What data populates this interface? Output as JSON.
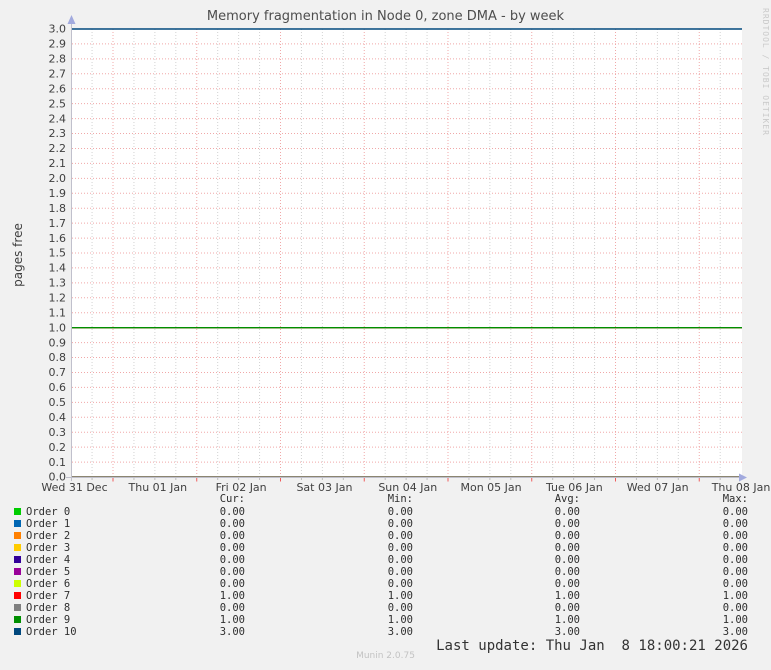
{
  "title": "Memory fragmentation in Node 0, zone DMA - by week",
  "watermark": "RRDTOOL / TOBI OETIKER",
  "footer": {
    "last_update": "Last update: Thu Jan  8 18:00:21 2026",
    "munin_version": "Munin 2.0.75"
  },
  "chart_data": {
    "type": "line",
    "title": "Memory fragmentation in Node 0, zone DMA - by week",
    "xlabel": "",
    "ylabel": "pages free",
    "ylim": [
      0.0,
      3.0
    ],
    "y_tick_step": 0.1,
    "grid": true,
    "x_tick_labels": [
      "Wed 31 Dec",
      "Thu 01 Jan",
      "Fri 02 Jan",
      "Sat 03 Jan",
      "Sun 04 Jan",
      "Mon 05 Jan",
      "Tue 06 Jan",
      "Wed 07 Jan",
      "Thu 08 Jan"
    ],
    "series": [
      {
        "name": "Order 0",
        "color": "#00CC00",
        "value": 0.0
      },
      {
        "name": "Order 1",
        "color": "#0066B3",
        "value": 0.0
      },
      {
        "name": "Order 2",
        "color": "#FF8000",
        "value": 0.0
      },
      {
        "name": "Order 3",
        "color": "#FFCC00",
        "value": 0.0
      },
      {
        "name": "Order 4",
        "color": "#330099",
        "value": 0.0
      },
      {
        "name": "Order 5",
        "color": "#990099",
        "value": 0.0
      },
      {
        "name": "Order 6",
        "color": "#CCFF00",
        "value": 0.0
      },
      {
        "name": "Order 7",
        "color": "#FF0000",
        "value": 1.0
      },
      {
        "name": "Order 8",
        "color": "#808080",
        "value": 0.0
      },
      {
        "name": "Order 9",
        "color": "#008F00",
        "value": 1.0
      },
      {
        "name": "Order 10",
        "color": "#00487D",
        "value": 3.0
      }
    ],
    "colors": {
      "grid_major": "#f0a8a8",
      "grid_minor": "#d2d2d2",
      "tick_major": "#ef5a5a",
      "tick_minor": "#bdbdbd",
      "axis": "#c0c0cc",
      "arrow": "#a2aade",
      "plot_bg": "#ffffff",
      "page_bg": "#f1f1f1"
    }
  },
  "legend": {
    "columns": [
      "Cur:",
      "Min:",
      "Avg:",
      "Max:"
    ],
    "rows": [
      {
        "label": "Order 0",
        "cur": "0.00",
        "min": "0.00",
        "avg": "0.00",
        "max": "0.00"
      },
      {
        "label": "Order 1",
        "cur": "0.00",
        "min": "0.00",
        "avg": "0.00",
        "max": "0.00"
      },
      {
        "label": "Order 2",
        "cur": "0.00",
        "min": "0.00",
        "avg": "0.00",
        "max": "0.00"
      },
      {
        "label": "Order 3",
        "cur": "0.00",
        "min": "0.00",
        "avg": "0.00",
        "max": "0.00"
      },
      {
        "label": "Order 4",
        "cur": "0.00",
        "min": "0.00",
        "avg": "0.00",
        "max": "0.00"
      },
      {
        "label": "Order 5",
        "cur": "0.00",
        "min": "0.00",
        "avg": "0.00",
        "max": "0.00"
      },
      {
        "label": "Order 6",
        "cur": "0.00",
        "min": "0.00",
        "avg": "0.00",
        "max": "0.00"
      },
      {
        "label": "Order 7",
        "cur": "1.00",
        "min": "1.00",
        "avg": "1.00",
        "max": "1.00"
      },
      {
        "label": "Order 8",
        "cur": "0.00",
        "min": "0.00",
        "avg": "0.00",
        "max": "0.00"
      },
      {
        "label": "Order 9",
        "cur": "1.00",
        "min": "1.00",
        "avg": "1.00",
        "max": "1.00"
      },
      {
        "label": "Order 10",
        "cur": "3.00",
        "min": "3.00",
        "avg": "3.00",
        "max": "3.00"
      }
    ]
  }
}
